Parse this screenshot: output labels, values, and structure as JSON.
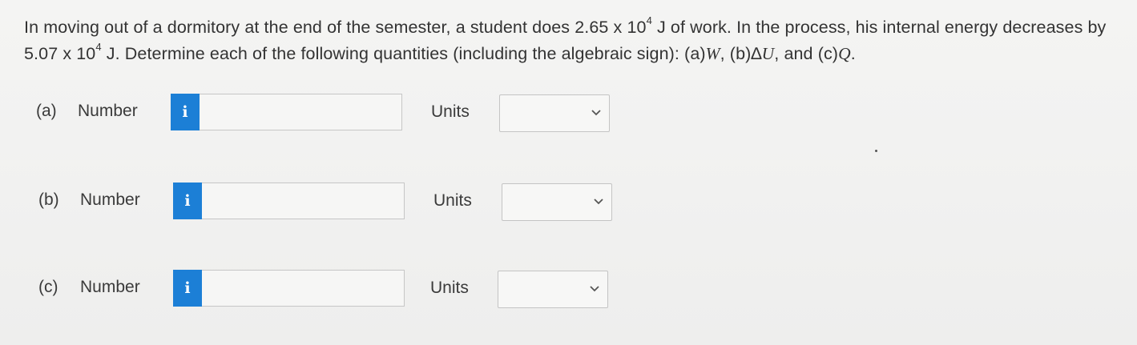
{
  "question": {
    "p1": "In moving out of a dormitory at the end of the semester, a student does 2.65 x 10",
    "p1_exp": "4",
    "p2": " J of work. In the process, his internal energy decreases by 5.07 x 10",
    "p2_exp": "4",
    "p3": " J. Determine each of the following quantities (including the algebraic sign): (a)",
    "var_w": "W",
    "p4": ", (b)",
    "delta": "∆",
    "var_u": "U",
    "p5": ", and (c)",
    "var_q": "Q",
    "p6": "."
  },
  "rows": [
    {
      "part": "(a)",
      "number_label": "Number",
      "info_icon": "i",
      "number_value": "",
      "units_label": "Units",
      "units_selected": ""
    },
    {
      "part": "(b)",
      "number_label": "Number",
      "info_icon": "i",
      "number_value": "",
      "units_label": "Units",
      "units_selected": ""
    },
    {
      "part": "(c)",
      "number_label": "Number",
      "info_icon": "i",
      "number_value": "",
      "units_label": "Units",
      "units_selected": ""
    }
  ],
  "colors": {
    "info_button": "#1c7fd6",
    "background": "#f2f2f1",
    "text": "#333333"
  },
  "icons": {
    "info": "info-icon",
    "dropdown": "chevron-down-icon"
  }
}
